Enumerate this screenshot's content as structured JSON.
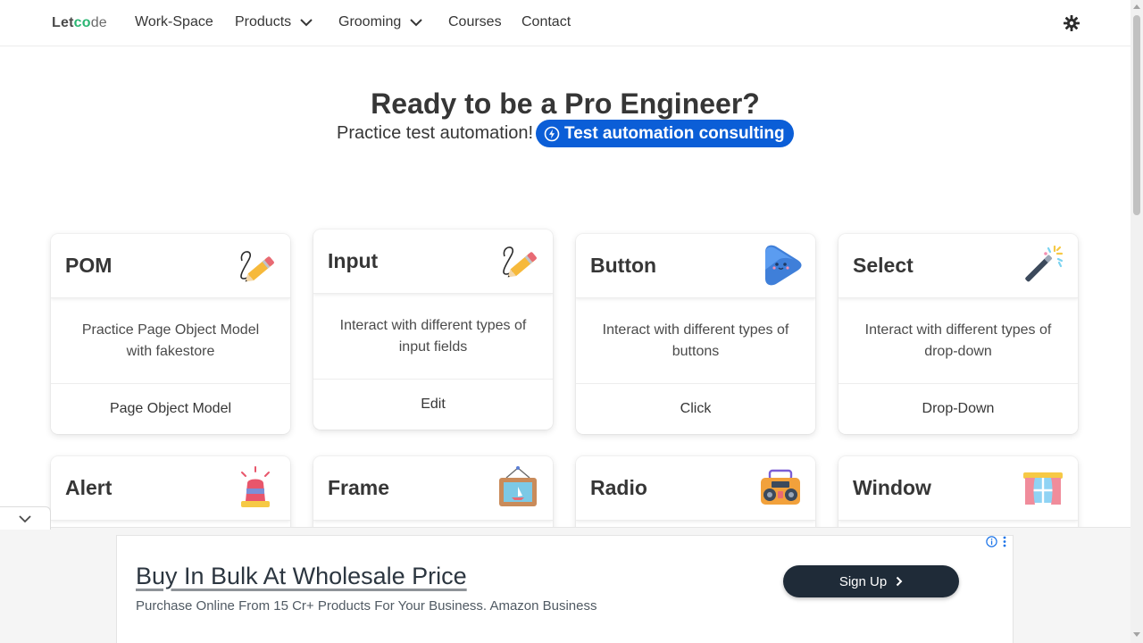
{
  "nav": {
    "brand_a": "Let",
    "brand_o": "co",
    "brand_b": "de",
    "items": [
      {
        "label": "Work-Space"
      },
      {
        "label": "Products"
      },
      {
        "label": "Grooming"
      },
      {
        "label": "Courses"
      },
      {
        "label": "Contact"
      }
    ],
    "theme_icon": "sun-gear-icon"
  },
  "hero": {
    "title": "Ready to be a Pro Engineer?",
    "subtitle": "Practice test automation!",
    "cta_label": "Test automation consulting",
    "cta_icon": "lightning-circle-icon",
    "accent": "#0b5ed7"
  },
  "cards": [
    {
      "title": "POM",
      "description": "Practice Page Object Model with fakestore",
      "action": "Page Object Model",
      "icon": "pencil-icon"
    },
    {
      "title": "Input",
      "description": "Interact with different types of input fields",
      "action": "Edit",
      "icon": "pencil-icon"
    },
    {
      "title": "Button",
      "description": "Interact with different types of buttons",
      "action": "Click",
      "icon": "play-icon"
    },
    {
      "title": "Select",
      "description": "Interact with different types of drop-down",
      "action": "Drop-Down",
      "icon": "magic-wand-icon"
    },
    {
      "title": "Alert",
      "icon": "siren-icon"
    },
    {
      "title": "Frame",
      "icon": "picture-frame-icon"
    },
    {
      "title": "Radio",
      "icon": "boombox-icon"
    },
    {
      "title": "Window",
      "icon": "window-icon"
    }
  ],
  "ad": {
    "headline": "Buy In Bulk At Wholesale Price",
    "description": "Purchase Online From 15 Cr+ Products For Your Business. Amazon Business",
    "cta_label": "Sign Up"
  }
}
